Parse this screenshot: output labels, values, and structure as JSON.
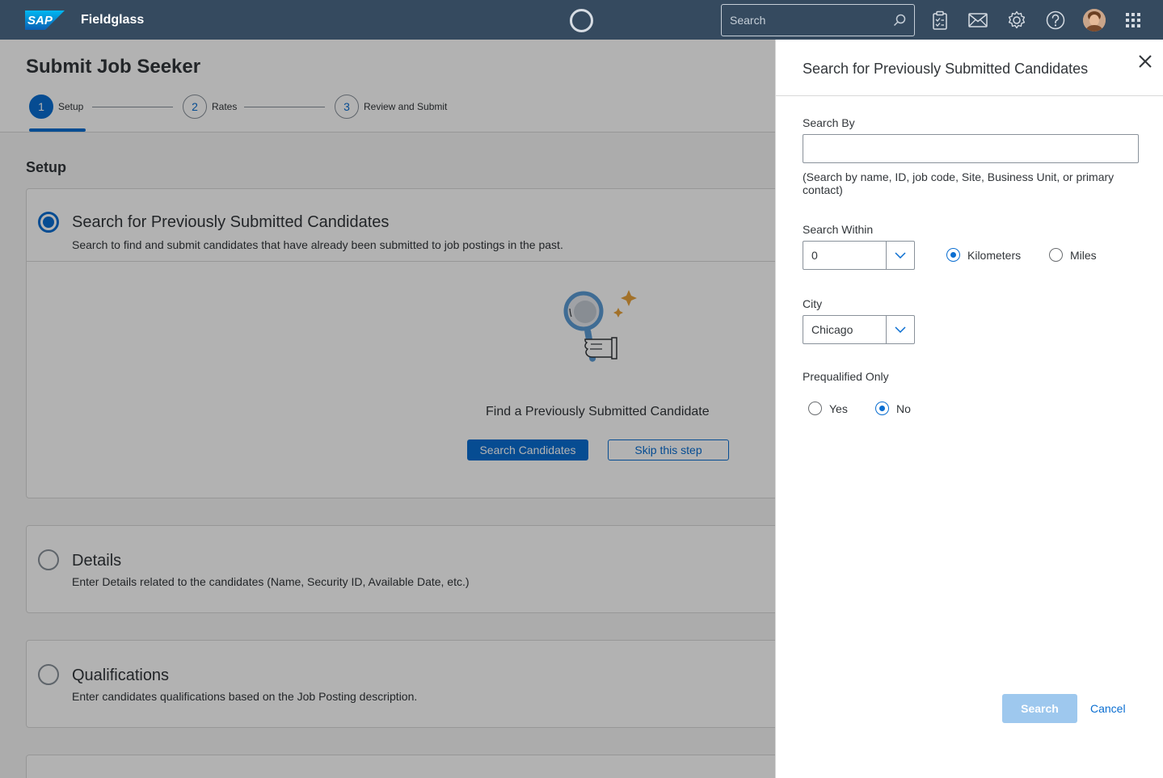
{
  "shellbar": {
    "brand": "SAP",
    "product": "Fieldglass",
    "search_placeholder": "Search",
    "icons": [
      "search-icon",
      "clipboard-icon",
      "mail-icon",
      "settings-icon",
      "help-icon",
      "avatar",
      "app-grid-icon"
    ]
  },
  "page": {
    "title": "Submit Job Seeker",
    "steps": [
      {
        "number": "1",
        "label": "Setup",
        "active": true
      },
      {
        "number": "2",
        "label": "Rates",
        "active": false
      },
      {
        "number": "3",
        "label": "Review and Submit",
        "active": false
      }
    ]
  },
  "content": {
    "section_title": "Setup",
    "cards": [
      {
        "title": "Search for Previously Submitted Candidates",
        "description": "Search to find and submit candidates that have already been submitted to job postings in the past.",
        "selected": true,
        "illustration_caption": "Find a Previously Submitted Candidate",
        "primary_button": "Search Candidates",
        "secondary_button": "Skip this step"
      },
      {
        "title": "Details",
        "description": "Enter Details related to the candidates (Name, Security ID, Available Date, etc.)",
        "selected": false
      },
      {
        "title": "Qualifications",
        "description": "Enter candidates qualifications based on the Job Posting description.",
        "selected": false
      }
    ]
  },
  "panel": {
    "title": "Search for Previously Submitted Candidates",
    "search_by": {
      "label": "Search By",
      "value": "",
      "hint": "(Search by name, ID, job code, Site, Business Unit, or primary contact)"
    },
    "search_within": {
      "label": "Search Within",
      "value": "0",
      "units": [
        {
          "label": "Kilometers",
          "selected": true
        },
        {
          "label": "Miles",
          "selected": false
        }
      ]
    },
    "city": {
      "label": "City",
      "value": "Chicago"
    },
    "prequalified": {
      "label": "Prequalified Only",
      "options": [
        {
          "label": "Yes",
          "selected": false
        },
        {
          "label": "No",
          "selected": true
        }
      ]
    },
    "search_button": "Search",
    "cancel_link": "Cancel"
  },
  "colors": {
    "shellbar": "#354a5f",
    "accent": "#0a6ed1",
    "disabled_button": "#9ec8ee",
    "illustration_accent": "#e9a23b"
  }
}
